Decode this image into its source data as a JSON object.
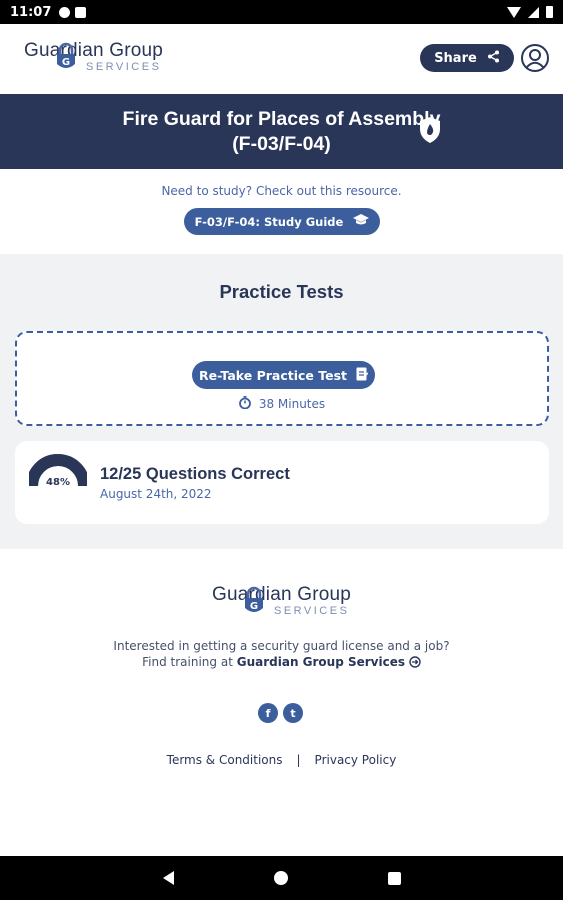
{
  "status_bar": {
    "time": "11:07"
  },
  "header": {
    "logo_title": "Guardian Group",
    "logo_subtitle": "SERVICES",
    "share_label": "Share"
  },
  "banner": {
    "title_line1": "Fire Guard for Places of Assembly",
    "title_line2": "(F-03/F-04)"
  },
  "study": {
    "prompt": "Need to study? Check out this resource.",
    "button_label": "F-03/F-04: Study Guide"
  },
  "practice": {
    "title": "Practice Tests",
    "retake_label": "Re-Take Practice Test",
    "duration": "38 Minutes",
    "result": {
      "percent": 48,
      "percent_label": "48%",
      "summary": "12/25 Questions Correct",
      "date": "August 24th, 2022"
    }
  },
  "footer": {
    "logo_title": "Guardian Group",
    "logo_subtitle": "SERVICES",
    "line1": "Interested in getting a security guard license and a job?",
    "line2_prefix": "Find training at",
    "line2_link": "Guardian Group Services",
    "facebook_glyph": "f",
    "twitter_glyph": "t",
    "terms": "Terms & Conditions",
    "separator": "|",
    "privacy": "Privacy Policy"
  },
  "colors": {
    "navy": "#2a3658",
    "accent": "#3d5e9c",
    "background": "#f1f2f4"
  }
}
